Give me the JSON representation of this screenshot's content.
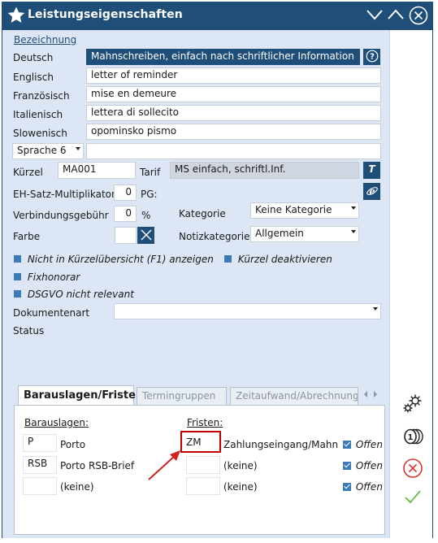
{
  "window": {
    "title": "Leistungseigenschaften"
  },
  "form": {
    "heading": "Bezeichnung",
    "rows": {
      "deutsch": {
        "label": "Deutsch",
        "value": "Mahnschreiben, einfach nach schriftlicher Information"
      },
      "englisch": {
        "label": "Englisch",
        "value": "letter of reminder"
      },
      "franzoesisch": {
        "label": "Französisch",
        "value": "mise en demeure"
      },
      "italienisch": {
        "label": "Italienisch",
        "value": "lettera di sollecito"
      },
      "slowenisch": {
        "label": "Slowenisch",
        "value": "opominsko pismo"
      }
    },
    "sprache_select": "Sprache 6",
    "sprache_value": "",
    "kuerzel_label": "Kürzel",
    "kuerzel_value": "MA001",
    "tarif_label": "Tarif",
    "tarif_value": "MS einfach, schriftl.Inf.",
    "tarif_btn": "T",
    "eh_label": "EH-Satz-Multiplikator",
    "eh_value": "0",
    "pg_label": "PG:",
    "verb_label": "Verbindungsgebühr",
    "verb_value": "0",
    "verb_unit": "%",
    "kategorie_label": "Kategorie",
    "kategorie_value": "Keine Kategorie",
    "farbe_label": "Farbe",
    "notiz_label": "Notizkategorie",
    "notiz_value": "Allgemein",
    "chk_kurz": "Nicht in Kürzelübersicht (F1) anzeigen",
    "chk_deakt": "Kürzel deaktivieren",
    "chk_fix": "Fixhonorar",
    "chk_dsgvo": "DSGVO nicht relevant",
    "doku_label": "Dokumentenart",
    "doku_value": "",
    "status_label": "Status"
  },
  "tabs": [
    {
      "label": "Barauslagen/Fristen",
      "active": true
    },
    {
      "label": "Termingruppen",
      "active": false
    },
    {
      "label": "Zeitaufwand/Abrechnung",
      "active": false
    }
  ],
  "barauslagen": {
    "heading": "Barauslagen:",
    "rows": [
      {
        "code": "P",
        "name": "Porto"
      },
      {
        "code": "RSB",
        "name": "Porto RSB-Brief"
      },
      {
        "code": "",
        "name": "(keine)"
      }
    ]
  },
  "fristen": {
    "heading": "Fristen:",
    "rows": [
      {
        "code": "ZM",
        "name": "Zahlungseingang/Mahnkl...",
        "offen": "Offen"
      },
      {
        "code": "",
        "name": "(keine)",
        "offen": "Offen"
      },
      {
        "code": "",
        "name": "(keine)",
        "offen": "Offen"
      }
    ]
  },
  "colors": {
    "titlebar": "#1f4e79",
    "content_bg": "#dce6f4",
    "accent": "#3c7bb8",
    "highlight": "#c00000",
    "ok": "#66bb44"
  },
  "icons": [
    "star-icon",
    "chevron-down-icon",
    "chevron-up-icon",
    "close-icon",
    "help-icon",
    "ie-icon",
    "settings-icon",
    "coins-icon",
    "cancel-icon",
    "confirm-icon",
    "arrow-annotation-icon"
  ]
}
